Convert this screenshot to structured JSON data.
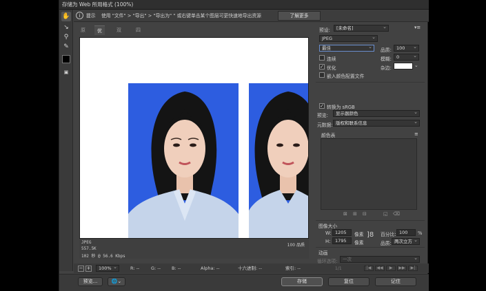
{
  "window": {
    "title": "存储为 Web 所用格式 (100%)"
  },
  "hint": {
    "label": "提示",
    "text": "使用 \"文件\" > \"导出\" > \"导出为\"   \" 或右键单击某个图层可更快速地导出资源",
    "learn_more": "了解更多"
  },
  "tabs": [
    {
      "label": "原稿"
    },
    {
      "label": "优化"
    },
    {
      "label": "双联"
    },
    {
      "label": "四联"
    }
  ],
  "image_info": {
    "format": "JPEG",
    "size": "557.5K",
    "time": "102 秒 @ 56.6 Kbps",
    "quality": "100 品质"
  },
  "status": {
    "zoom": "100%",
    "r": "R: --",
    "g": "G: --",
    "b": "B: --",
    "alpha": "Alpha: --",
    "hex": "十六进制: --",
    "index": "索引: --"
  },
  "buttons": {
    "preview": "预览...",
    "save": "存储",
    "reset": "复位",
    "remember": "记住"
  },
  "settings": {
    "preset_label": "预设:",
    "preset_value": "[未命名]",
    "format_value": "JPEG",
    "compression_value": "最佳",
    "quality_label": "品质:",
    "quality_value": "100",
    "progressive_label": "连续",
    "blur_label": "模糊:",
    "blur_value": "0",
    "optimized_label": "优化",
    "matte_label": "杂边:",
    "embed_profile_label": "嵌入颜色配置文件",
    "convert_srgb_label": "转换为 sRGB",
    "preview_label": "预览:",
    "preview_value": "显示器颜色",
    "metadata_label": "元数据:",
    "metadata_value": "版权和联系信息",
    "color_table_label": "颜色表"
  },
  "image_size": {
    "header": "图像大小",
    "w_label": "W:",
    "w_value": "1205",
    "w_unit": "像素",
    "h_label": "H:",
    "h_value": "1795",
    "h_unit": "像素",
    "percent_label": "百分比:",
    "percent_value": "100",
    "percent_unit": "%",
    "quality_label": "品质:",
    "quality_value": "两次立方"
  },
  "animation": {
    "header": "动画",
    "loop_label": "循环选项:",
    "loop_value": "一次",
    "frame_counter": "1/1"
  },
  "colors": {
    "photo_background": "#2d5de0",
    "matte": "#ffffff"
  }
}
